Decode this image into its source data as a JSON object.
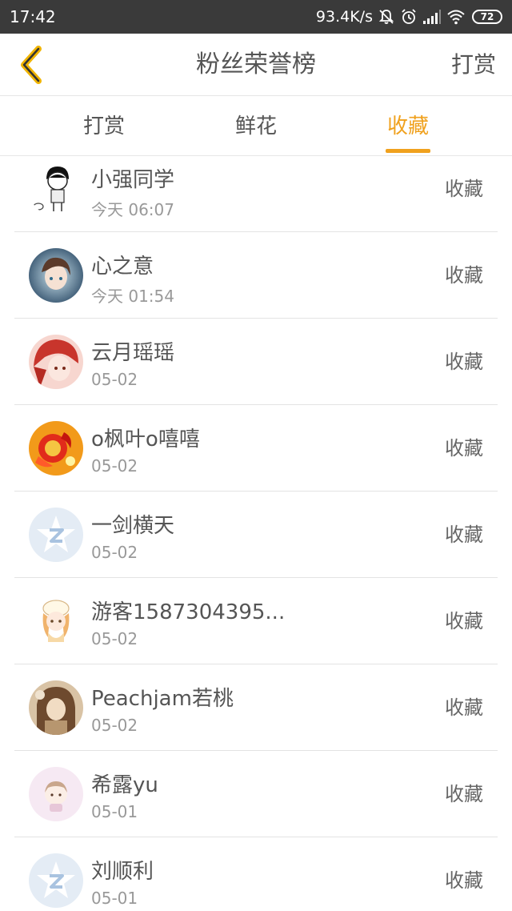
{
  "status_bar": {
    "time": "17:42",
    "speed": "93.4K/s",
    "icons": [
      "mute-bell-icon",
      "alarm-icon",
      "signal-icon",
      "wifi-icon"
    ],
    "battery": "72"
  },
  "header": {
    "back_icon": "chevron-left-icon",
    "title": "粉丝荣誉榜",
    "action": "打赏",
    "accent_color": "#f0a11e"
  },
  "tabs": [
    {
      "label": "打赏",
      "active": false
    },
    {
      "label": "鲜花",
      "active": false
    },
    {
      "label": "收藏",
      "active": true
    }
  ],
  "list": [
    {
      "name": "小强同学",
      "time": "今天 06:07",
      "action": "收藏",
      "avatar": "cartoon-boy-avatar"
    },
    {
      "name": "心之意",
      "time": "今天 01:54",
      "action": "收藏",
      "avatar": "anime-girl-avatar"
    },
    {
      "name": "云月瑶瑶",
      "time": "05-02",
      "action": "收藏",
      "avatar": "red-hair-anime-avatar"
    },
    {
      "name": "o枫叶o嘻嘻",
      "time": "05-02",
      "action": "收藏",
      "avatar": "red-flower-avatar"
    },
    {
      "name": "一剑横天",
      "time": "05-02",
      "action": "收藏",
      "avatar": "default-star-avatar"
    },
    {
      "name": "游客1587304395...",
      "time": "05-02",
      "action": "收藏",
      "avatar": "chibi-girl-avatar"
    },
    {
      "name": "Peachjam若桃",
      "time": "05-02",
      "action": "收藏",
      "avatar": "sepia-photo-avatar"
    },
    {
      "name": "希露yu",
      "time": "05-01",
      "action": "收藏",
      "avatar": "pink-chibi-avatar"
    },
    {
      "name": "刘顺利",
      "time": "05-01",
      "action": "收藏",
      "avatar": "default-star-avatar"
    }
  ]
}
